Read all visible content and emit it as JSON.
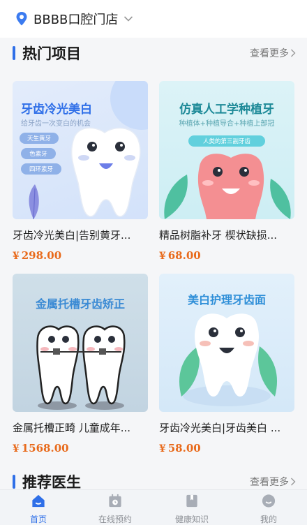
{
  "store": {
    "name": "BBBB口腔门店"
  },
  "sections": {
    "hot": {
      "title": "热门项目",
      "more_label": "查看更多"
    },
    "doctors": {
      "title": "推荐医生",
      "more_label": "查看更多"
    }
  },
  "products": [
    {
      "name": "牙齿冷光美白|告别黄牙...",
      "price": "298.00",
      "image": {
        "title": "牙齿冷光美白",
        "subtitle": "给牙齿一次变白的机会",
        "tags": [
          "天生黄牙",
          "色素牙",
          "四环素牙"
        ]
      }
    },
    {
      "name": "精品树脂补牙 楔状缺损...",
      "price": "68.00",
      "image": {
        "title": "仿真人工学种植牙",
        "subtitle": "种植体+种植导合+种植上部冠",
        "badge": "人类的第三副牙齿"
      }
    },
    {
      "name": "金属托槽正畸 儿童成年...",
      "price": "1568.00",
      "image": {
        "title": "金属托槽牙齿矫正"
      }
    },
    {
      "name": "牙齿冷光美白|牙齿美白 ...",
      "price": "58.00",
      "image": {
        "title": "美白护理牙齿面"
      }
    }
  ],
  "currency_symbol": "¥",
  "tabbar": [
    {
      "label": "首页",
      "icon": "home-icon",
      "active": true
    },
    {
      "label": "在线预约",
      "icon": "calendar-icon",
      "active": false
    },
    {
      "label": "健康知识",
      "icon": "bookmark-icon",
      "active": false
    },
    {
      "label": "我的",
      "icon": "smile-face-icon",
      "active": false
    }
  ],
  "colors": {
    "accent": "#2f6fe8",
    "price": "#e86a1b"
  }
}
